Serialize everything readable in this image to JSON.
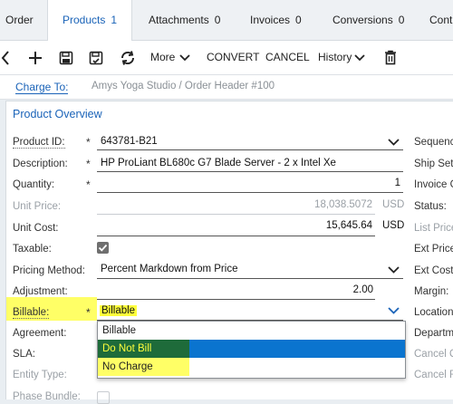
{
  "tabs": [
    {
      "label": "Order",
      "count": ""
    },
    {
      "label": "Products",
      "count": "1"
    },
    {
      "label": "Attachments",
      "count": "0"
    },
    {
      "label": "Invoices",
      "count": "0"
    },
    {
      "label": "Conversions",
      "count": "0"
    },
    {
      "label": "Cont",
      "count": ""
    }
  ],
  "toolbar": {
    "more_label": "More",
    "convert_label": "CONVERT",
    "cancel_label": "CANCEL",
    "history_label": "History"
  },
  "charge": {
    "label": "Charge To:",
    "value": "Amys Yoga Studio / Order Header #100"
  },
  "section_title": "Product Overview",
  "fields": {
    "product_id": {
      "label": "Product ID:",
      "value": "643781-B21"
    },
    "description": {
      "label": "Description:",
      "value": "HP ProLiant BL680c G7  Blade Server - 2 x Intel Xe"
    },
    "quantity": {
      "label": "Quantity:",
      "value": "1"
    },
    "unit_price": {
      "label": "Unit Price:",
      "value": "18,038.5072",
      "currency": "USD"
    },
    "unit_cost": {
      "label": "Unit Cost:",
      "value": "15,645.64",
      "currency": "USD"
    },
    "taxable": {
      "label": "Taxable:",
      "checked": true
    },
    "pricing_method": {
      "label": "Pricing Method:",
      "value": "Percent Markdown from Price"
    },
    "adjustment": {
      "label": "Adjustment:",
      "value": "2.00"
    },
    "margin_label": "Margin:",
    "billable": {
      "label": "Billable:",
      "value": "Billable"
    },
    "agreement": {
      "label": "Agreement:"
    },
    "sla": {
      "label": "SLA:"
    },
    "entity_type": {
      "label": "Entity Type:"
    },
    "phase_bundle": {
      "label": "Phase Bundle:"
    }
  },
  "required_mark": "*",
  "right_labels": [
    "Sequenc",
    "Ship Set:",
    "Invoice G",
    "Status:",
    "List Price",
    "Ext Price",
    "Ext Cost:",
    "Margin:",
    "Location",
    "Departm",
    "Cancel Q",
    "Cancel R"
  ],
  "billable_options": [
    "Billable",
    "Do Not Bill",
    "No Charge"
  ],
  "colors": {
    "accent": "#1a63b8",
    "highlight": "#ffff3a",
    "selected": "#0a74cf",
    "hover": "#1e6b3a"
  }
}
